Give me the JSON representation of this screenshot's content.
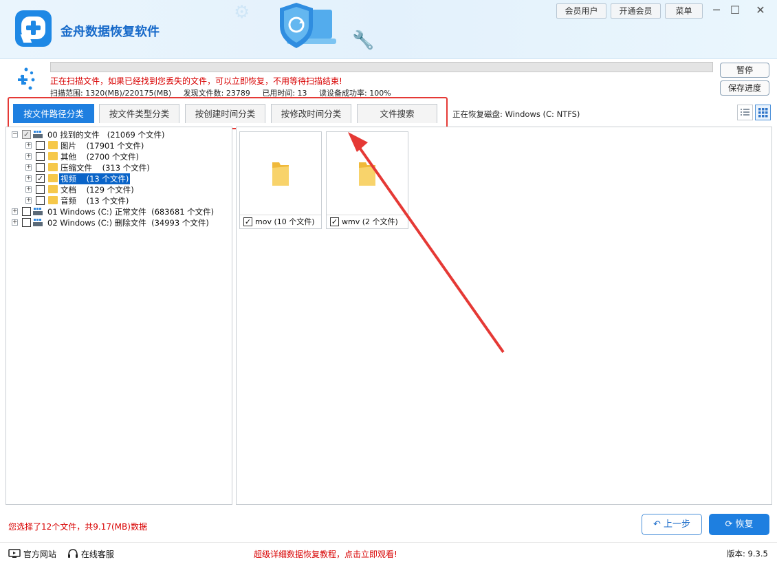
{
  "app": {
    "title": "金舟数据恢复软件",
    "top_buttons": [
      "会员用户",
      "开通会员",
      "菜单"
    ],
    "window_controls": [
      "─",
      "☐",
      "✕"
    ]
  },
  "scan": {
    "progress_percent": 0,
    "message": "正在扫描文件，如果已经找到您丢失的文件，可以立即恢复，不用等待扫描结束!",
    "range": "扫描范围: 1320(MB)/220175(MB)",
    "found": "发现文件数: 23789",
    "elapsed": "已用时间: 13",
    "read_rate": "读设备成功率: 100%",
    "pause_label": "暂停",
    "save_label": "保存进度"
  },
  "tabs": [
    {
      "label": "按文件路径分类",
      "active": true
    },
    {
      "label": "按文件类型分类",
      "active": false
    },
    {
      "label": "按创建时间分类",
      "active": false
    },
    {
      "label": "按修改时间分类",
      "active": false
    },
    {
      "label": "文件搜索",
      "active": false
    }
  ],
  "disk_label": "正在恢复磁盘: Windows (C: NTFS)",
  "tree": {
    "root": {
      "label": "00 找到的文件",
      "count": "(21069 个文件)"
    },
    "children": [
      {
        "label": "图片",
        "count": "(17901 个文件)",
        "checked": false,
        "selected": false
      },
      {
        "label": "其他",
        "count": "(2700 个文件)",
        "checked": false,
        "selected": false
      },
      {
        "label": "压缩文件",
        "count": "(313 个文件)",
        "checked": false,
        "selected": false
      },
      {
        "label": "视频",
        "count": "(13 个文件)",
        "checked": true,
        "selected": true
      },
      {
        "label": "文档",
        "count": "(129 个文件)",
        "checked": false,
        "selected": false
      },
      {
        "label": "音频",
        "count": "(13 个文件)",
        "checked": false,
        "selected": false
      }
    ],
    "drives": [
      {
        "label": "01 Windows (C:) 正常文件",
        "count": "(683681 个文件)"
      },
      {
        "label": "02 Windows (C:) 删除文件",
        "count": "(34993 个文件)"
      }
    ]
  },
  "files": [
    {
      "name": "mov",
      "count": "(10 个文件)",
      "checked": true
    },
    {
      "name": "wmv",
      "count": "(2 个文件)",
      "checked": true
    }
  ],
  "selection_info": "您选择了12个文件，共9.17(MB)数据",
  "buttons": {
    "back": "上一步",
    "recover": "恢复"
  },
  "footer": {
    "website": "官方网站",
    "support": "在线客服",
    "tutorial": "超级详细数据恢复教程，点击立即观看!",
    "version": "版本: 9.3.5"
  },
  "colors": {
    "accent": "#1e7fe0",
    "warning_text": "#d80000",
    "highlight_border": "#e53935"
  }
}
